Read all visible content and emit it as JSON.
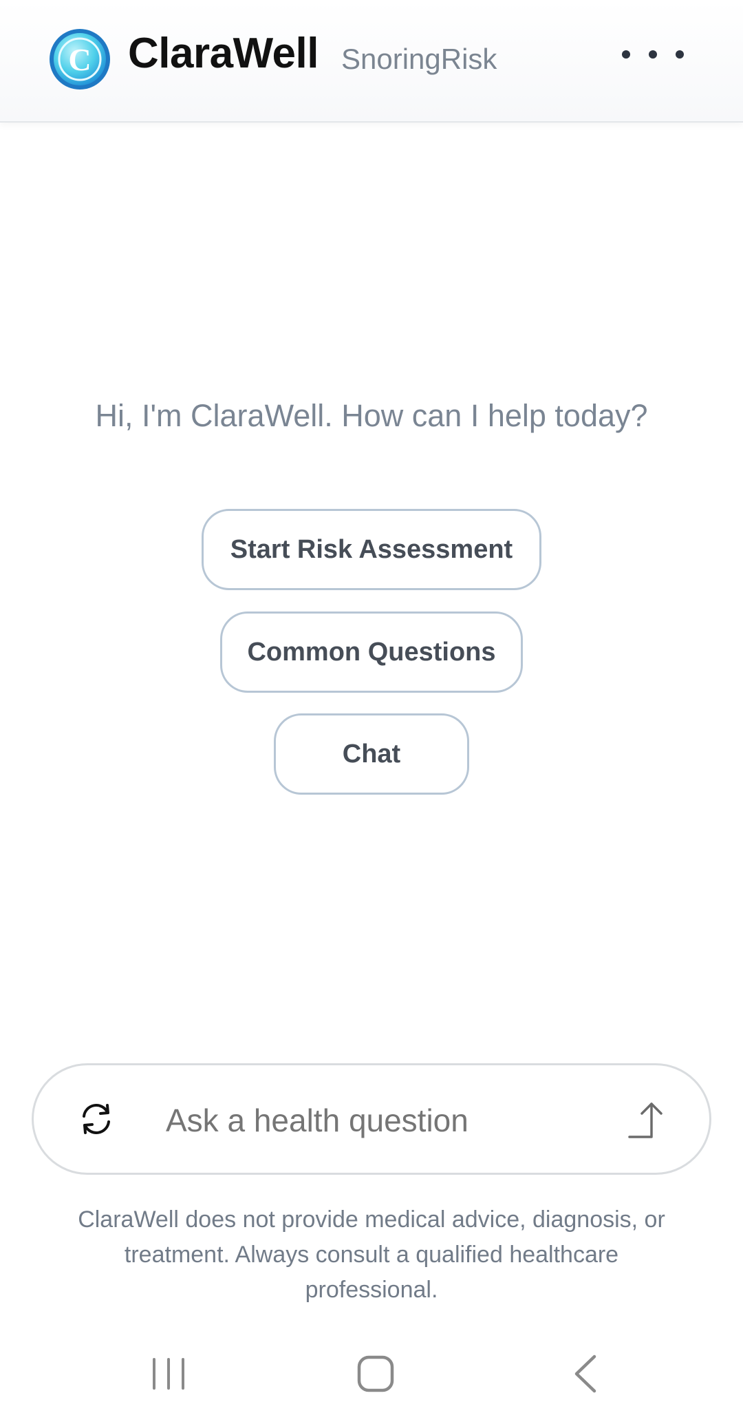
{
  "header": {
    "brand": "ClaraWell",
    "subbrand": "SnoringRisk",
    "logo_letter": "C",
    "menu_icon": "more-horizontal-icon"
  },
  "main": {
    "greeting": "Hi, I'm ClaraWell. How can I help today?",
    "options": [
      {
        "label": "Start Risk Assessment"
      },
      {
        "label": "Common Questions"
      },
      {
        "label": "Chat"
      }
    ]
  },
  "composer": {
    "placeholder": "Ask a health question",
    "refresh_icon": "refresh-icon",
    "send_icon": "send-arrow-icon"
  },
  "disclaimer": "ClaraWell does not provide medical advice, diagnosis, or treatment. Always consult a qualified healthcare professional.",
  "navbar": {
    "recents_icon": "recents-icon",
    "home_icon": "home-icon",
    "back_icon": "back-icon"
  },
  "colors": {
    "logo_blue": "#1f8fd6",
    "logo_cyan": "#4fd0ea",
    "option_border": "#b7c6d5",
    "text_muted": "#7a8593"
  }
}
